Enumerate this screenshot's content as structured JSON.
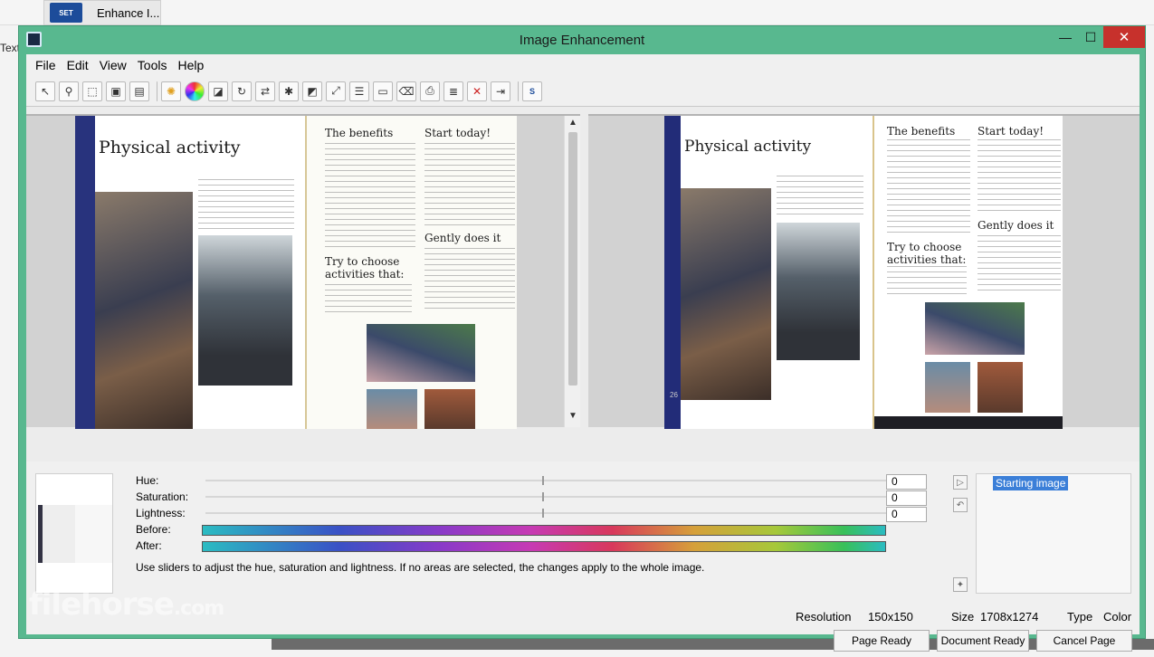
{
  "taskbar": {
    "tab_label": "Enhance I...",
    "tab_logo_text": "SET",
    "side_text": "Text"
  },
  "window": {
    "title": "Image Enhancement"
  },
  "menu": [
    "File",
    "Edit",
    "View",
    "Tools",
    "Help"
  ],
  "toolbar": {
    "icons": [
      "select-arrow-icon",
      "zoom-icon",
      "marquee-select-icon",
      "crop-icon",
      "page-frame-icon",
      "brightness-icon",
      "color-wheel-icon",
      "deskew-icon",
      "rotate-icon",
      "page-flip-icon",
      "despeckle-icon",
      "mask-icon",
      "resize-icon",
      "document-icon",
      "scanner-icon",
      "eraser-icon",
      "stamp-icon",
      "report-icon",
      "delete-page-icon",
      "export-icon",
      "set-logo-icon"
    ]
  },
  "preview": {
    "left_page": {
      "heading": "Physical activity",
      "sections": [
        "The benefits",
        "Start today!",
        "Try to choose activities that:",
        "Gently does it"
      ]
    },
    "right_page": {
      "heading": "Physical activity",
      "sections": [
        "The benefits",
        "Start today!",
        "Try to choose activities that:",
        "Gently does it"
      ],
      "page_number": "26"
    }
  },
  "adjustments": {
    "hue": {
      "label": "Hue:",
      "value": "0"
    },
    "saturation": {
      "label": "Saturation:",
      "value": "0"
    },
    "lightness": {
      "label": "Lightness:",
      "value": "0"
    },
    "before_label": "Before:",
    "after_label": "After:",
    "hint": "Use sliders to adjust the hue, saturation and lightness. If no areas are selected, the changes apply to the whole image."
  },
  "history": {
    "items": [
      "Starting image"
    ]
  },
  "status": {
    "resolution_label": "Resolution",
    "resolution_value": "150x150",
    "size_label": "Size",
    "size_value": "1708x1274",
    "type_label": "Type",
    "type_value": "Color"
  },
  "buttons": {
    "page_ready": "Page Ready",
    "document_ready": "Document Ready",
    "cancel_page": "Cancel Page"
  },
  "watermark": {
    "text": "filehorse",
    "suffix": ".com"
  }
}
